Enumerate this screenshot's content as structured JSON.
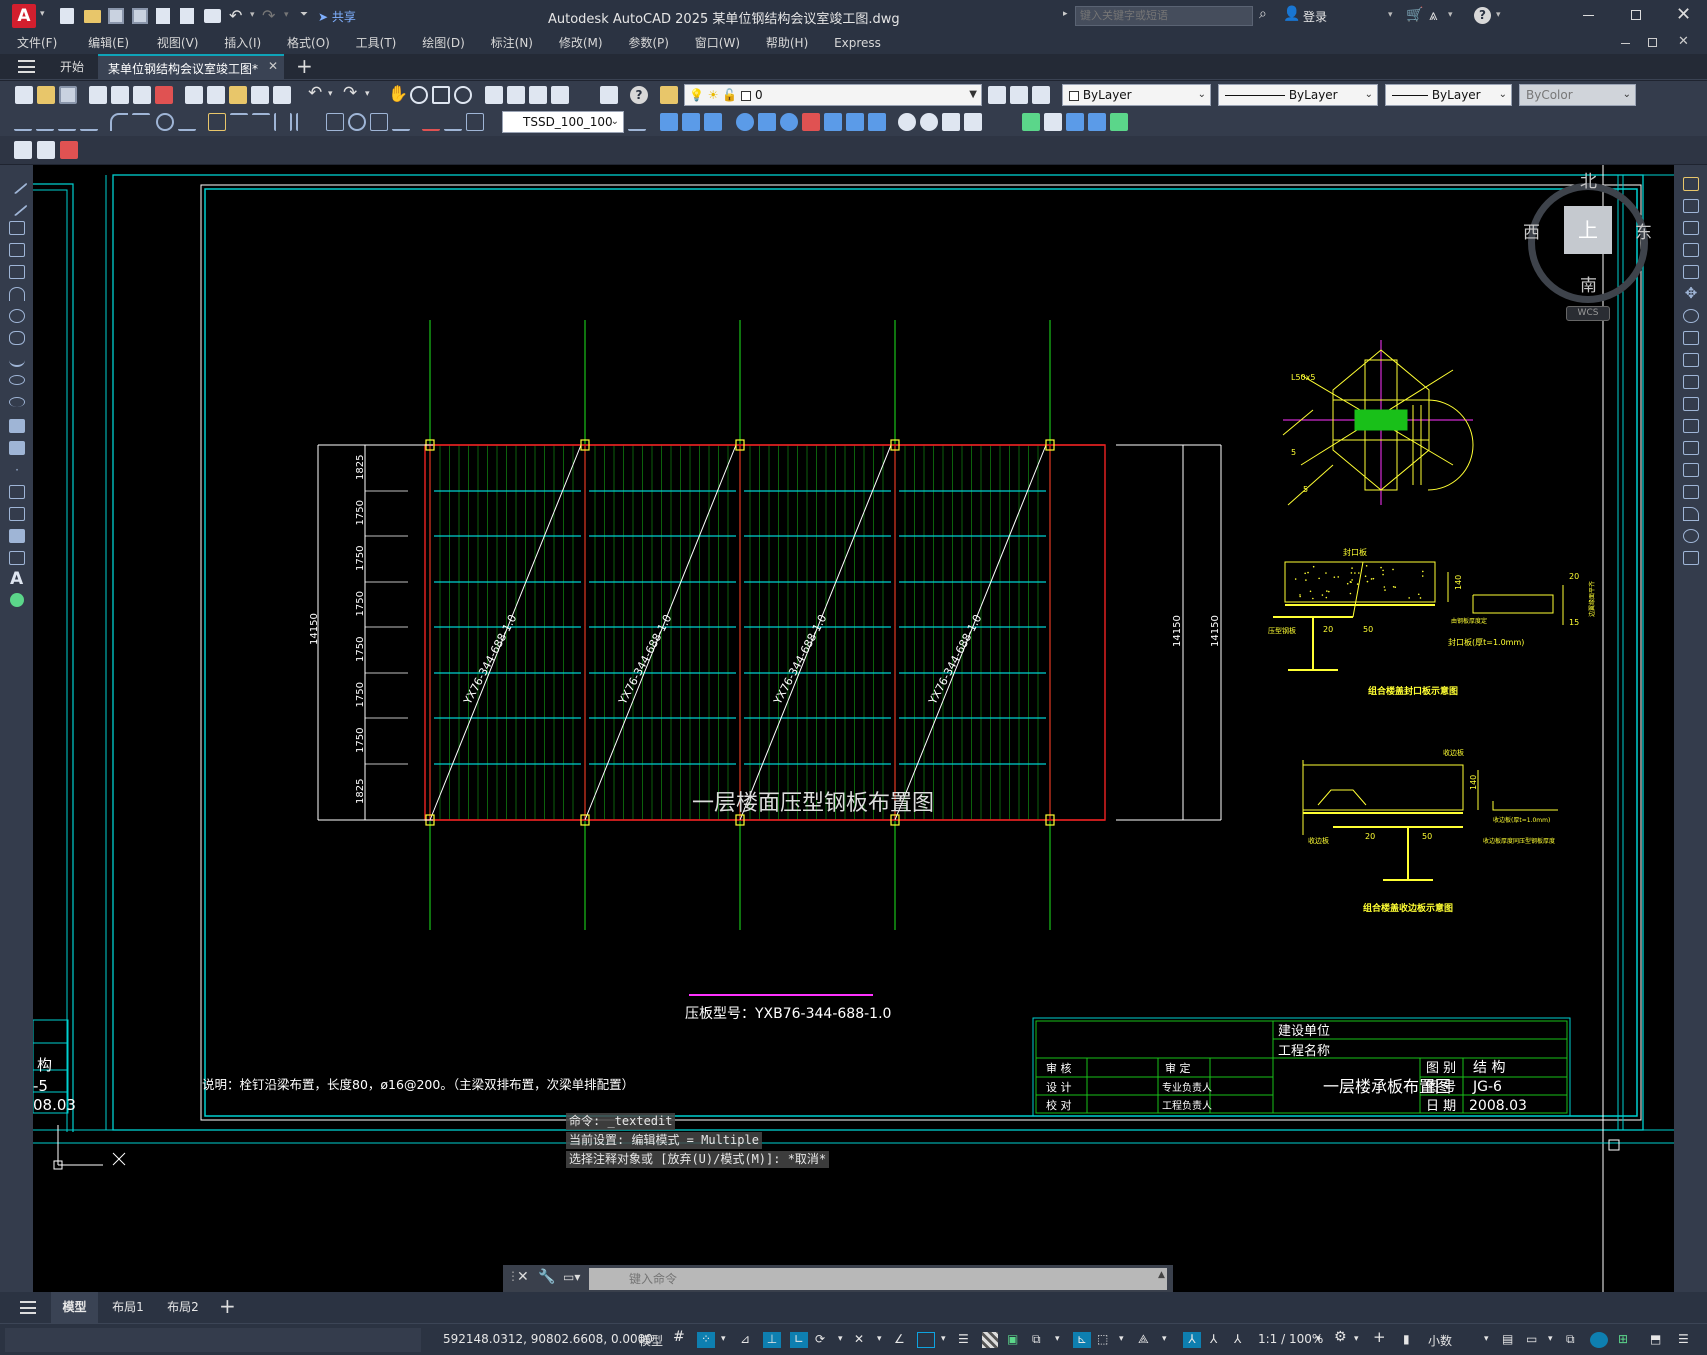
{
  "window": {
    "app_logo": "A",
    "title": "Autodesk AutoCAD 2025    某单位钢结构会议室竣工图.dwg",
    "search_placeholder": "键入关键字或短语",
    "login": "登录",
    "share": "共享"
  },
  "menu": [
    "文件(F)",
    "编辑(E)",
    "视图(V)",
    "插入(I)",
    "格式(O)",
    "工具(T)",
    "绘图(D)",
    "标注(N)",
    "修改(M)",
    "参数(P)",
    "窗口(W)",
    "帮助(H)",
    "Express"
  ],
  "tabs": {
    "start": "开始",
    "active": "某单位钢结构会议室竣工图*"
  },
  "toolbar": {
    "layer": "0",
    "dimstyle": "TSSD_100_100",
    "color": "ByLayer",
    "linetype": "ByLayer",
    "lineweight": "ByLayer",
    "plotstyle": "ByColor"
  },
  "viewcube": {
    "north": "北",
    "south": "南",
    "east": "东",
    "west": "西",
    "top": "上",
    "wcs": "WCS"
  },
  "drawing": {
    "title": "一层楼面压型钢板布置图",
    "deck_label": "YX76-344-688-1.0",
    "dims_left": [
      "1825",
      "1750",
      "1750",
      "1750",
      "1750",
      "1750",
      "1750",
      "1825"
    ],
    "total_dim": "14150",
    "note_model": "压板型号：YXB76-344-688-1.0",
    "note": "说明：栓钉沿梁布置，长度80，ø16@200。（主梁双排布置，次梁单排配置）",
    "detail1_labels": [
      "L50x5",
      "5",
      "5"
    ],
    "detail2_title": "组合楼盖封口板示意图",
    "detail2_labels": [
      "封口板",
      "140",
      "压型钢板",
      "20",
      "50",
      "封口板(厚t=1.0mm)",
      "15",
      "20",
      "由钢板厚度定",
      "边翼缘面平齐"
    ],
    "detail3_title": "组合楼盖收边板示意图",
    "detail3_labels": [
      "收边板",
      "140",
      "20",
      "50",
      "收边板",
      "收边板(厚t=1.0mm)",
      "收边板厚度同压型钢板厚度"
    ]
  },
  "titleblock": {
    "client_label": "建设单位",
    "project_label": "工程名称",
    "rows": [
      [
        "审 核",
        "",
        "审 定",
        ""
      ],
      [
        "设 计",
        "",
        "专业负责人",
        ""
      ],
      [
        "校 对",
        "",
        "工程负责人",
        ""
      ]
    ],
    "drawing_name": "一层楼承板布置图",
    "type_label": "图 别",
    "type_value": "结 构",
    "no_label": "图 号",
    "no_value": "JG-6",
    "date_label": "日 期",
    "date_value": "2008.03"
  },
  "left_partial": {
    "c1": "构",
    "c2": "-5",
    "c3": "08.03"
  },
  "command": {
    "h1": "命令: _textedit",
    "h2": "当前设置: 编辑模式 = Multiple",
    "h3": "选择注释对象或 [放弃(U)/模式(M)]: *取消*",
    "placeholder": "键入命令"
  },
  "layout_tabs": [
    "模型",
    "布局1",
    "布局2"
  ],
  "status": {
    "coords": "592148.0312, 90802.6608, 0.0000",
    "space": "模型",
    "scale": "1:1 / 100%",
    "units": "小数"
  },
  "colors": {
    "accent": "#0ea3b8",
    "green": "#19c019",
    "red": "#e02020",
    "yellow": "#ffff33",
    "cyan": "#00d0d0",
    "magenta": "#ff33ff"
  }
}
